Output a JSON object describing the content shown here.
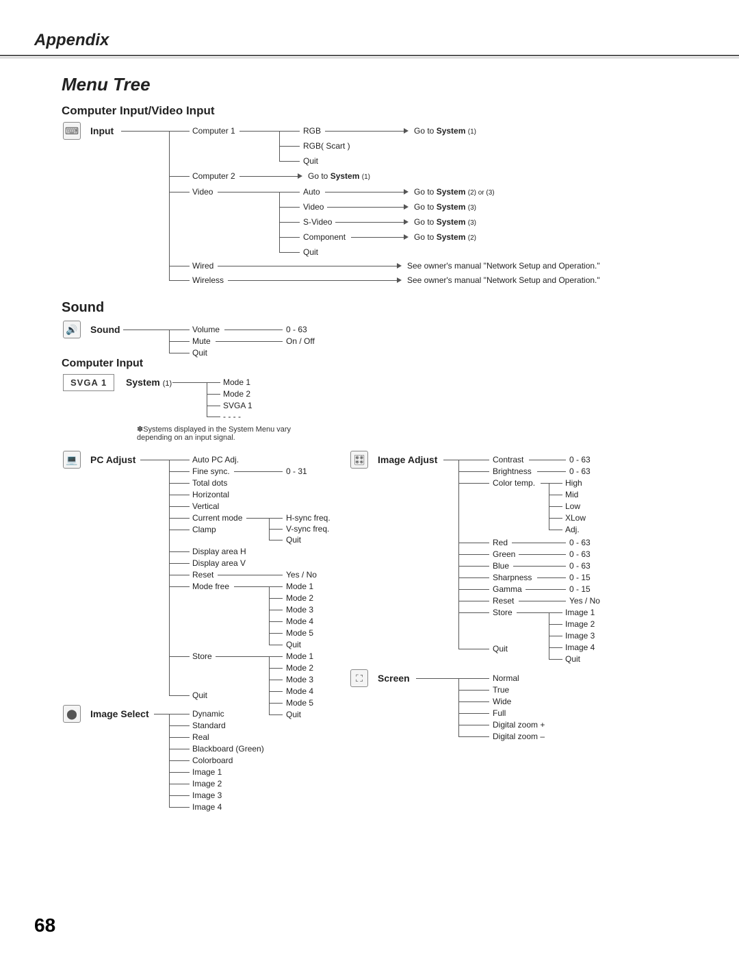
{
  "header": {
    "appendix": "Appendix",
    "menutree": "Menu Tree"
  },
  "section1": {
    "title": "Computer Input/Video Input",
    "input_label": "Input",
    "computer1": "Computer 1",
    "computer2": "Computer 2",
    "video": "Video",
    "wired": "Wired",
    "wireless": "Wireless",
    "rgb": "RGB",
    "rgbscart": "RGB( Scart )",
    "quit": "Quit",
    "auto": "Auto",
    "video2": "Video",
    "svideo": "S-Video",
    "component": "Component",
    "goto_system1": "Go to System (1)",
    "goto_system1b": "Go to System (1)",
    "goto_system2or3": "Go to System (2) or (3)",
    "goto_system3a": "Go to System (3)",
    "goto_system3b": "Go to System (3)",
    "goto_system2": "Go to System (2)",
    "manual_note_a": "See owner's manual \"Network Setup and Operation.\"",
    "manual_note_b": "See owner's manual \"Network Setup and Operation.\""
  },
  "sound": {
    "title": "Sound",
    "label": "Sound",
    "volume": "Volume",
    "mute": "Mute",
    "quit": "Quit",
    "volrange": "0 - 63",
    "onoff": "On / Off"
  },
  "computer_input": {
    "title": "Computer Input",
    "svga": "SVGA 1",
    "system": "System (1)",
    "mode1": "Mode 1",
    "mode2": "Mode 2",
    "svga1": "SVGA 1",
    "dashes": "- - - -",
    "footnote": "✽Systems displayed in the System Menu vary depending on an input signal."
  },
  "pcadjust": {
    "label": "PC Adjust",
    "autopc": "Auto PC Adj.",
    "finesync": "Fine sync.",
    "totaldots": "Total dots",
    "horizontal": "Horizontal",
    "vertical": "Vertical",
    "currentmode": "Current mode",
    "clamp": "Clamp",
    "displayh": "Display area H",
    "displayv": "Display area V",
    "reset": "Reset",
    "modefree": "Mode free",
    "store": "Store",
    "quit": "Quit",
    "r031": "0 - 31",
    "hsync": "H-sync freq.",
    "vsync": "V-sync freq.",
    "quit2": "Quit",
    "yesno": "Yes / No",
    "m1": "Mode 1",
    "m2": "Mode 2",
    "m3": "Mode 3",
    "m4": "Mode 4",
    "m5": "Mode 5",
    "quit3": "Quit",
    "sm1": "Mode 1",
    "sm2": "Mode 2",
    "sm3": "Mode 3",
    "sm4": "Mode 4",
    "sm5": "Mode 5",
    "squit": "Quit"
  },
  "imageselect": {
    "label": "Image Select",
    "dynamic": "Dynamic",
    "standard": "Standard",
    "real": "Real",
    "blackboard": "Blackboard (Green)",
    "colorboard": "Colorboard",
    "image1": "Image 1",
    "image2": "Image 2",
    "image3": "Image 3",
    "image4": "Image 4"
  },
  "imageadjust": {
    "label": "Image Adjust",
    "contrast": "Contrast",
    "brightness": "Brightness",
    "colortemp": "Color temp.",
    "high": "High",
    "mid": "Mid",
    "low": "Low",
    "xlow": "XLow",
    "adj": "Adj.",
    "red": "Red",
    "green": "Green",
    "blue": "Blue",
    "sharpness": "Sharpness",
    "gamma": "Gamma",
    "reset": "Reset",
    "store": "Store",
    "quit": "Quit",
    "r063a": "0 - 63",
    "r063b": "0 - 63",
    "r063c": "0 - 63",
    "r063d": "0 - 63",
    "r063e": "0 - 63",
    "r015a": "0 - 15",
    "r015b": "0 - 15",
    "yesno": "Yes / No",
    "im1": "Image 1",
    "im2": "Image 2",
    "im3": "Image 3",
    "im4": "Image 4",
    "quit2": "Quit"
  },
  "screen": {
    "label": "Screen",
    "normal": "Normal",
    "true": "True",
    "wide": "Wide",
    "full": "Full",
    "dzoomp": "Digital zoom +",
    "dzoomm": "Digital zoom –"
  },
  "pagenum": "68"
}
